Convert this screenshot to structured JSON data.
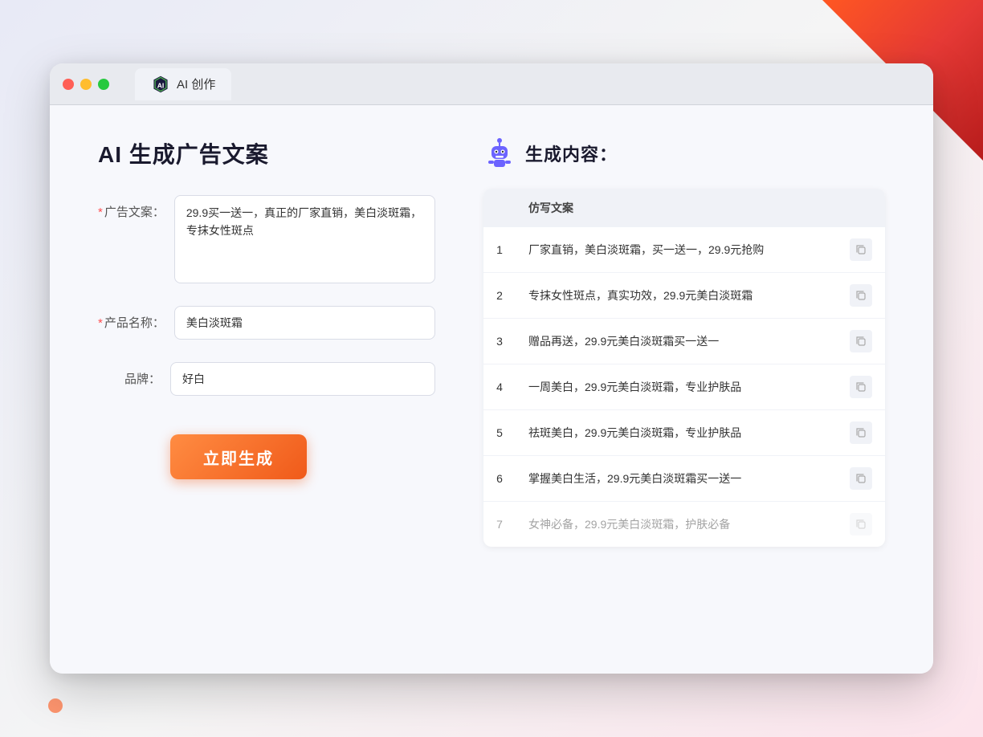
{
  "browser": {
    "tab_label": "AI 创作"
  },
  "page": {
    "title": "AI 生成广告文案",
    "right_title": "生成内容："
  },
  "form": {
    "ad_copy_label": "广告文案：",
    "ad_copy_required": "*",
    "ad_copy_value": "29.9买一送一，真正的厂家直销，美白淡斑霜，专抹女性斑点",
    "product_name_label": "产品名称：",
    "product_name_required": "*",
    "product_name_value": "美白淡斑霜",
    "brand_label": "品牌：",
    "brand_value": "好白",
    "generate_button": "立即生成"
  },
  "results": {
    "column_header": "仿写文案",
    "items": [
      {
        "num": 1,
        "text": "厂家直销，美白淡斑霜，买一送一，29.9元抢购"
      },
      {
        "num": 2,
        "text": "专抹女性斑点，真实功效，29.9元美白淡斑霜"
      },
      {
        "num": 3,
        "text": "赠品再送，29.9元美白淡斑霜买一送一"
      },
      {
        "num": 4,
        "text": "一周美白，29.9元美白淡斑霜，专业护肤品"
      },
      {
        "num": 5,
        "text": "祛斑美白，29.9元美白淡斑霜，专业护肤品"
      },
      {
        "num": 6,
        "text": "掌握美白生活，29.9元美白淡斑霜买一送一"
      },
      {
        "num": 7,
        "text": "女神必备，29.9元美白淡斑霜，护肤必备",
        "faded": true
      }
    ]
  }
}
